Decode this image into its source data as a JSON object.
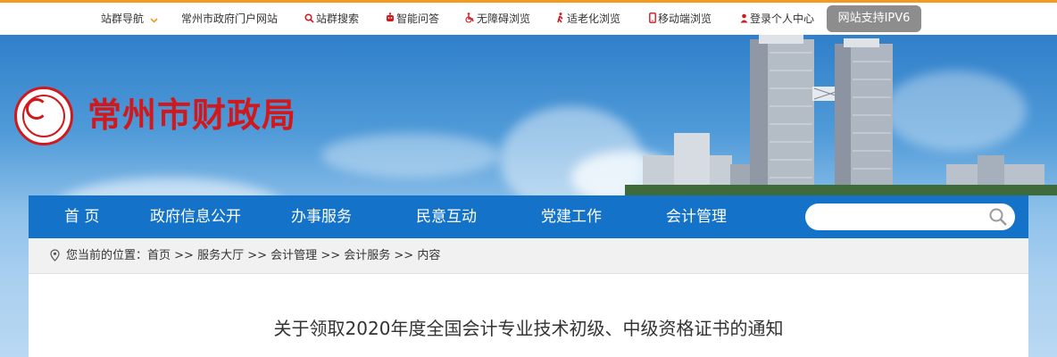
{
  "topbar": {
    "links": [
      {
        "label": "站群导航",
        "icon": "chevron-down-icon"
      },
      {
        "label": "常州市政府门户网站",
        "icon": ""
      },
      {
        "label": "站群搜索",
        "icon": "search-icon"
      },
      {
        "label": "智能问答",
        "icon": "robot-icon"
      },
      {
        "label": "无障碍浏览",
        "icon": "wheelchair-icon"
      },
      {
        "label": "适老化浏览",
        "icon": "elderly-icon"
      },
      {
        "label": "移动端浏览",
        "icon": "mobile-icon"
      },
      {
        "label": "登录个人中心",
        "icon": "user-icon"
      }
    ],
    "ipv6_badge": "网站支持IPV6",
    "accent_color": "#f29b1f"
  },
  "header": {
    "site_title": "常州市财政局",
    "logo_icon": "dragon-emblem-icon",
    "title_color": "#d1191d"
  },
  "nav": {
    "items": [
      "首 页",
      "政府信息公开",
      "办事服务",
      "民意互动",
      "党建工作",
      "会计管理"
    ],
    "search_placeholder": "",
    "bg_color": "#1473c9"
  },
  "breadcrumb": {
    "prefix": "您当前的位置：",
    "items": [
      "首页",
      "服务大厅",
      "会计管理",
      "会计服务",
      "内容"
    ],
    "separator": " >> "
  },
  "article": {
    "title": "关于领取2020年度全国会计专业技术初级、中级资格证书的通知"
  }
}
